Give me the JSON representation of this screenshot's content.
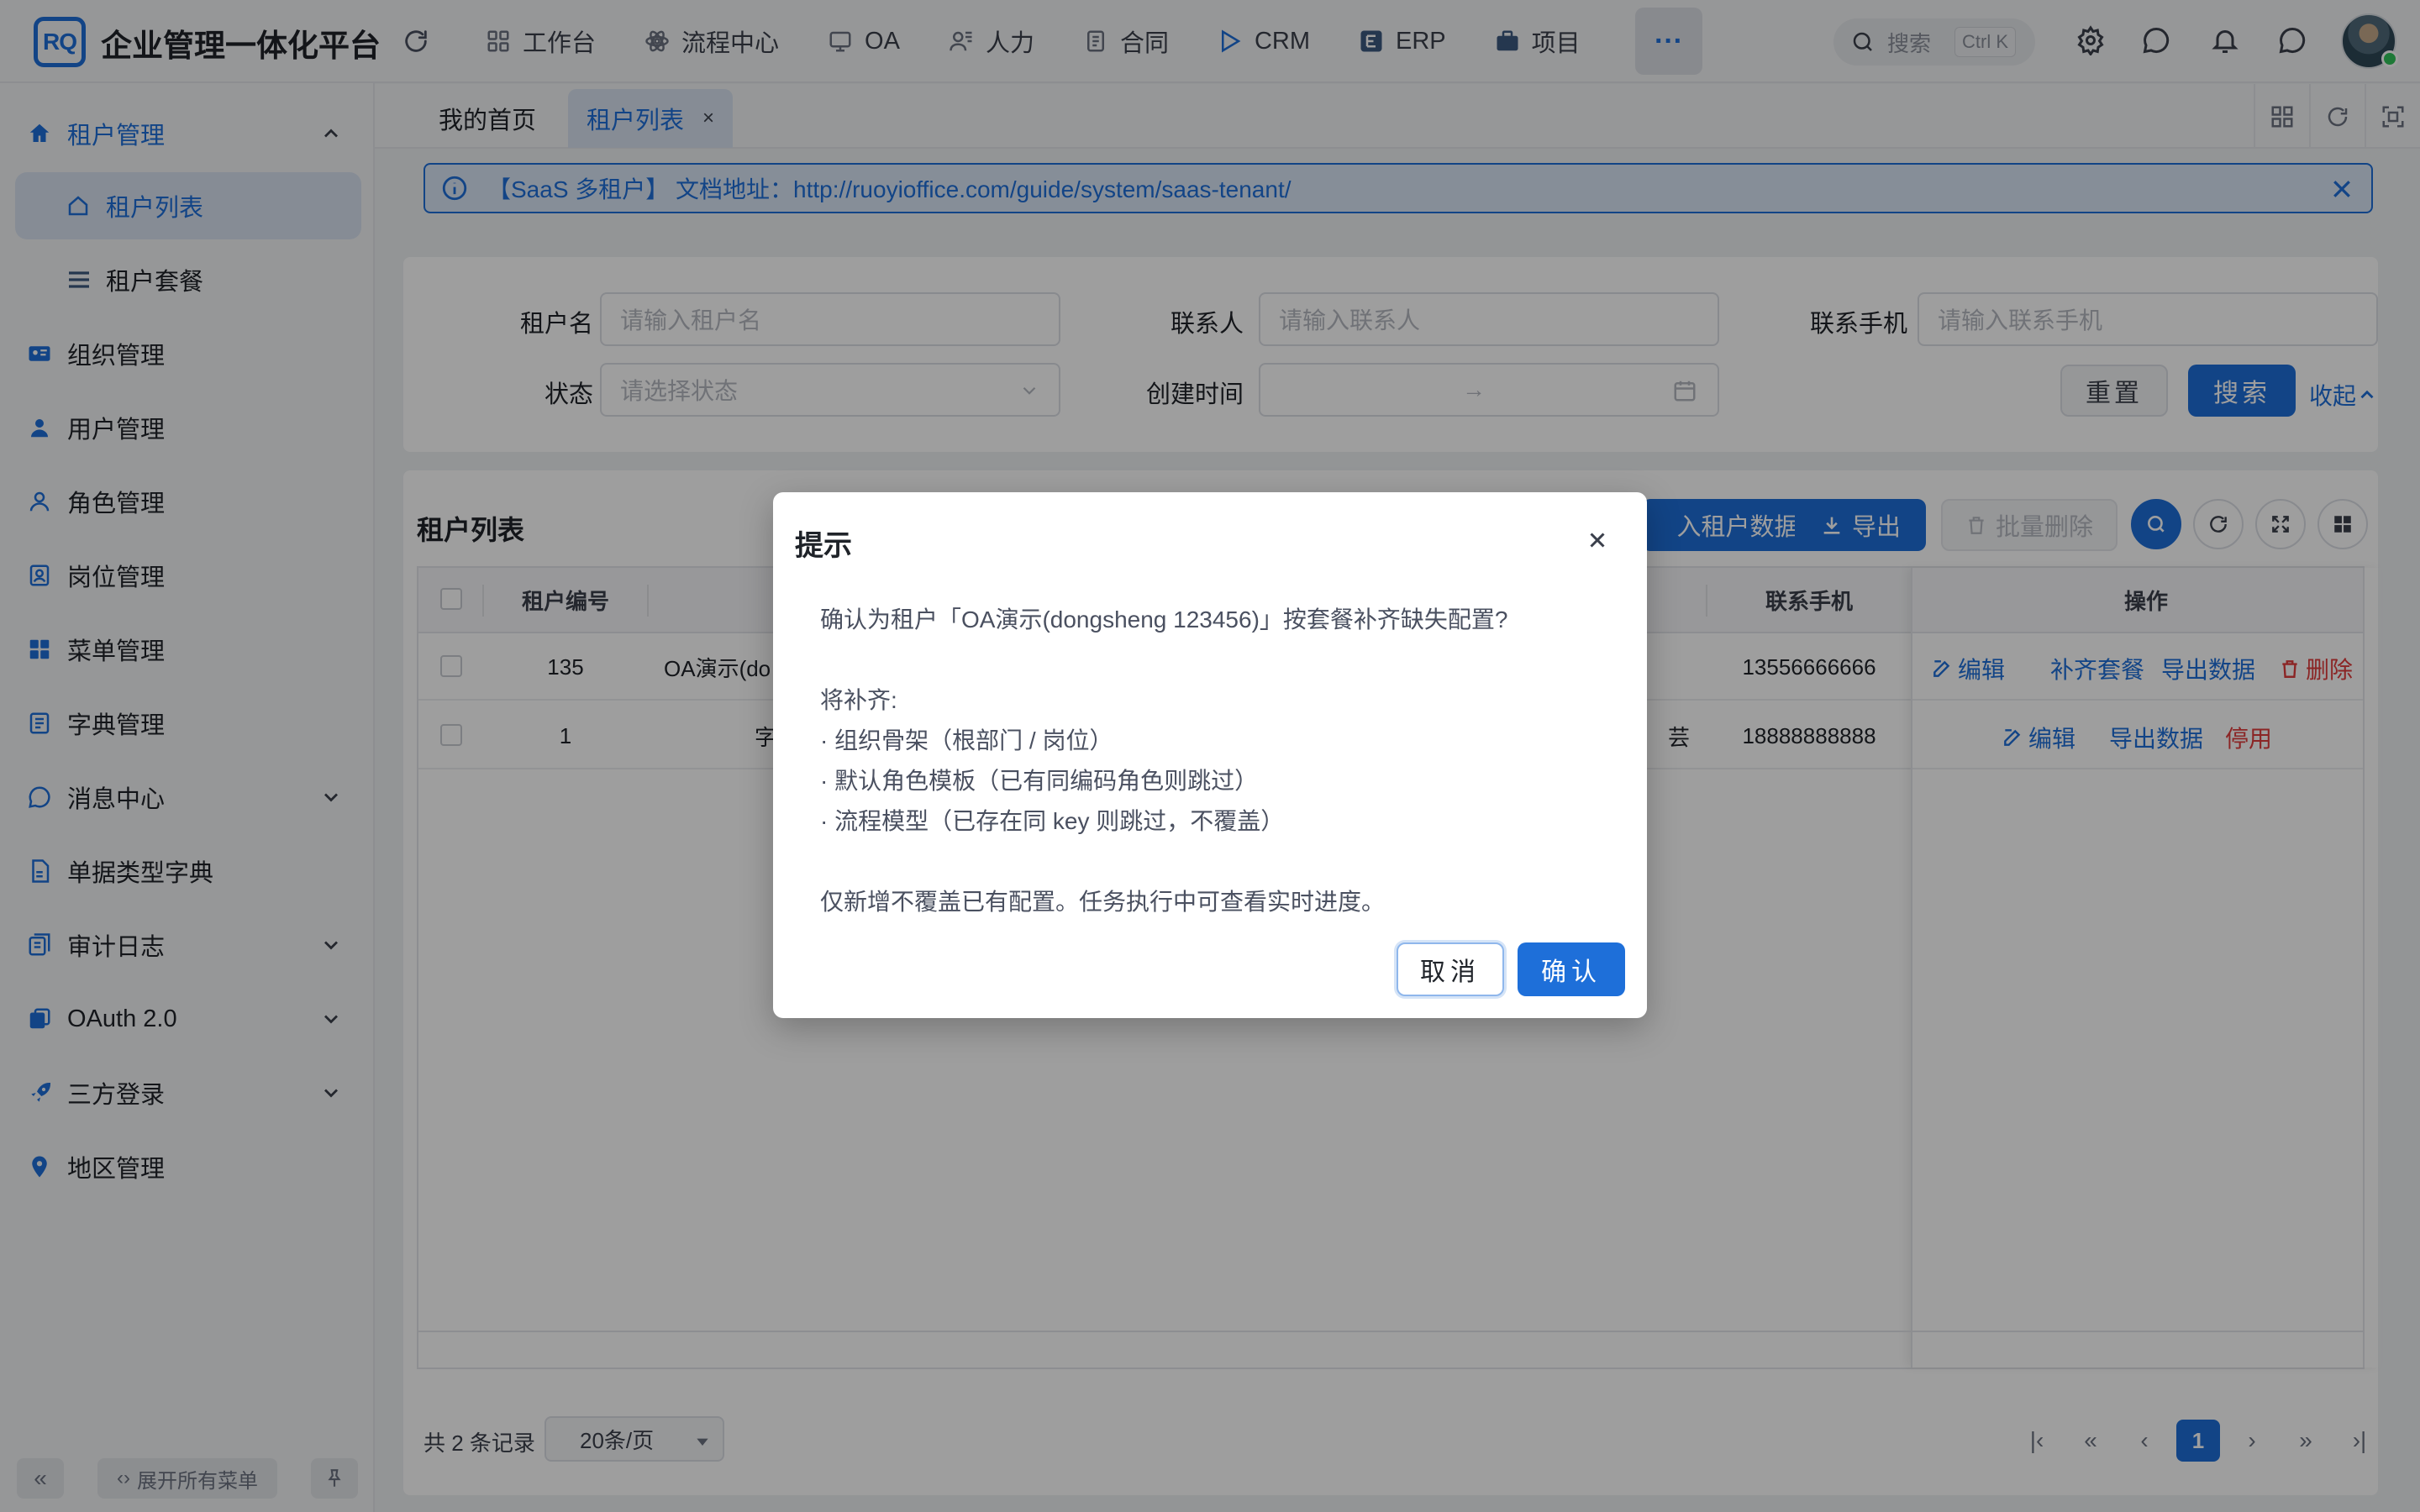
{
  "app": {
    "logo_text": "RQ",
    "title": "企业管理一体化平台"
  },
  "topnav": {
    "items": [
      {
        "label": "工作台",
        "icon": "dashboard-icon"
      },
      {
        "label": "流程中心",
        "icon": "workflow-icon"
      },
      {
        "label": "OA",
        "icon": "oa-icon"
      },
      {
        "label": "人力",
        "icon": "people-icon"
      },
      {
        "label": "合同",
        "icon": "contract-icon"
      },
      {
        "label": "CRM",
        "icon": "crm-icon"
      },
      {
        "label": "ERP",
        "icon": "erp-icon"
      },
      {
        "label": "项目",
        "icon": "project-icon"
      }
    ],
    "more_label": "···",
    "search_placeholder": "搜索",
    "search_shortcut": "Ctrl K"
  },
  "sidebar": {
    "group_label": "租户管理",
    "sub_items": [
      {
        "label": "租户列表",
        "active": true
      },
      {
        "label": "租户套餐",
        "active": false
      }
    ],
    "items": [
      {
        "label": "组织管理",
        "icon": "id-card-icon"
      },
      {
        "label": "用户管理",
        "icon": "user-icon"
      },
      {
        "label": "角色管理",
        "icon": "user-outline-icon"
      },
      {
        "label": "岗位管理",
        "icon": "post-icon"
      },
      {
        "label": "菜单管理",
        "icon": "menu-grid-icon"
      },
      {
        "label": "字典管理",
        "icon": "dictionary-icon"
      },
      {
        "label": "消息中心",
        "icon": "message-icon",
        "expandable": true
      },
      {
        "label": "单据类型字典",
        "icon": "document-icon"
      },
      {
        "label": "审计日志",
        "icon": "log-icon",
        "expandable": true
      },
      {
        "label": "OAuth 2.0",
        "icon": "oauth-icon",
        "expandable": true
      },
      {
        "label": "三方登录",
        "icon": "rocket-icon",
        "expandable": true
      },
      {
        "label": "地区管理",
        "icon": "location-icon"
      }
    ],
    "collapse_label": "«",
    "expand_all_label": "展开所有菜单"
  },
  "tabs": {
    "items": [
      {
        "label": "我的首页",
        "active": false
      },
      {
        "label": "租户列表",
        "active": true
      }
    ],
    "close_label": "×"
  },
  "alert": {
    "text": "【SaaS 多租户】 文档地址：http://ruoyioffice.com/guide/system/saas-tenant/"
  },
  "filters": {
    "tenant_name_label": "租户名",
    "tenant_name_placeholder": "请输入租户名",
    "contact_label": "联系人",
    "contact_placeholder": "请输入联系人",
    "mobile_label": "联系手机",
    "mobile_placeholder": "请输入联系手机",
    "status_label": "状态",
    "status_placeholder": "请选择状态",
    "created_label": "创建时间",
    "range_separator": "→",
    "reset_label": "重置",
    "search_label": "搜索",
    "collapse_label": "收起"
  },
  "table_card": {
    "title": "租户列表",
    "import_label": "入租户数据",
    "export_label": "导出",
    "batch_delete_label": "批量删除",
    "columns": {
      "id": "租户编号",
      "mobile": "联系手机",
      "actions": "操作"
    },
    "rows": [
      {
        "id": "135",
        "name": "OA演示(do",
        "contact_tail": "",
        "mobile": "13556666666",
        "actions": [
          "编辑",
          "补齐套餐",
          "导出数据",
          "删除"
        ]
      },
      {
        "id": "1",
        "name": "字",
        "contact_tail": "芸",
        "mobile": "18888888888",
        "actions": [
          "编辑",
          "导出数据",
          "停用"
        ]
      }
    ],
    "total_text": "共 2 条记录",
    "page_size": "20条/页",
    "current_page": "1"
  },
  "modal": {
    "title": "提示",
    "line1": "确认为租户「OA演示(dongsheng 123456)」按套餐补齐缺失配置?",
    "line2": "将补齐:",
    "bullet1": "· 组织骨架（根部门 / 岗位）",
    "bullet2": "· 默认角色模板（已有同编码角色则跳过）",
    "bullet3": "· 流程模型（已存在同 key 则跳过，不覆盖）",
    "line3": "仅新增不覆盖已有配置。任务执行中可查看实时进度。",
    "cancel_label": "取消",
    "confirm_label": "确认"
  },
  "colors": {
    "primary": "#1e6fd9",
    "danger": "#e03c3c",
    "mask": "rgba(0,0,0,0.38)"
  }
}
